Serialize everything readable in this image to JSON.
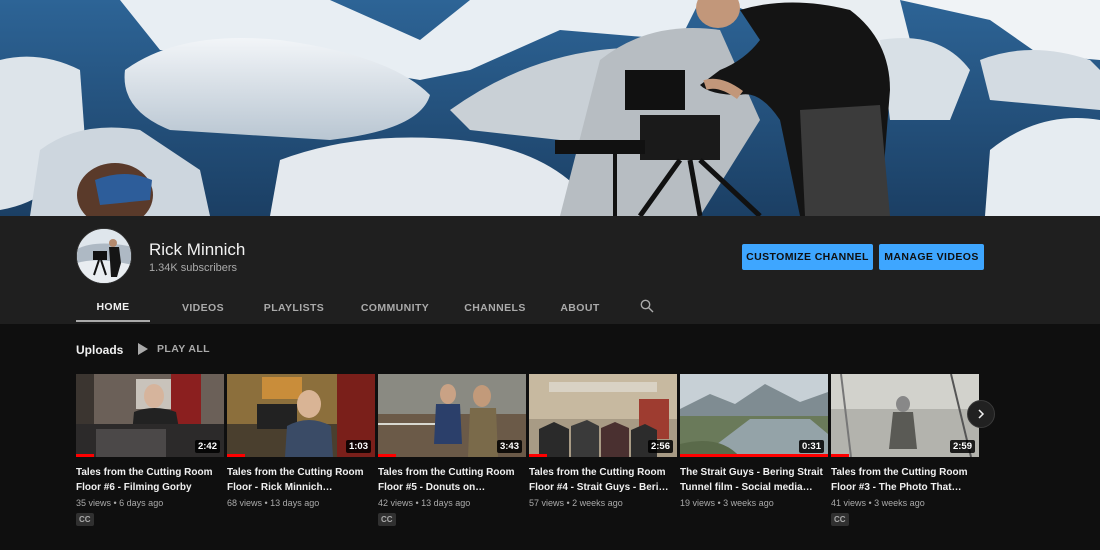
{
  "channel": {
    "name": "Rick Minnich",
    "subscribers": "1.34K subscribers"
  },
  "buttons": {
    "customize": "CUSTOMIZE CHANNEL",
    "manage": "MANAGE VIDEOS"
  },
  "tabs": [
    {
      "label": "HOME",
      "active": true
    },
    {
      "label": "VIDEOS",
      "active": false
    },
    {
      "label": "PLAYLISTS",
      "active": false
    },
    {
      "label": "COMMUNITY",
      "active": false
    },
    {
      "label": "CHANNELS",
      "active": false
    },
    {
      "label": "ABOUT",
      "active": false
    }
  ],
  "icons": {
    "search": "search-icon",
    "play_all": "play-icon",
    "next": "chevron-right-icon"
  },
  "uploads": {
    "title": "Uploads",
    "play_all": "PLAY ALL",
    "videos": [
      {
        "title": "Tales from the Cutting Room Floor #6 - Filming Gorby",
        "meta": "35 views • 6 days ago",
        "duration": "2:42",
        "cc": "CC",
        "progress": 0.12
      },
      {
        "title": "Tales from the Cutting Room Floor - Rick Minnich…",
        "meta": "68 views • 13 days ago",
        "duration": "1:03",
        "cc": "",
        "progress": 0.12
      },
      {
        "title": "Tales from the Cutting Room Floor #5 - Donuts on…",
        "meta": "42 views • 13 days ago",
        "duration": "3:43",
        "cc": "CC",
        "progress": 0.12
      },
      {
        "title": "Tales from the Cutting Room Floor #4 - Strait Guys - Beri…",
        "meta": "57 views • 2 weeks ago",
        "duration": "2:56",
        "cc": "",
        "progress": 0.12
      },
      {
        "title": "The Strait Guys - Bering Strait Tunnel film - Social media…",
        "meta": "19 views • 3 weeks ago",
        "duration": "0:31",
        "cc": "",
        "progress": 1.0
      },
      {
        "title": "Tales from the Cutting Room Floor #3 - The Photo That…",
        "meta": "41 views • 3 weeks ago",
        "duration": "2:59",
        "cc": "CC",
        "progress": 0.12
      }
    ]
  },
  "colors": {
    "accent": "#3ea6ff",
    "progress": "#ff0000",
    "background": "#0f0f0f",
    "header": "#1f1f1f"
  }
}
